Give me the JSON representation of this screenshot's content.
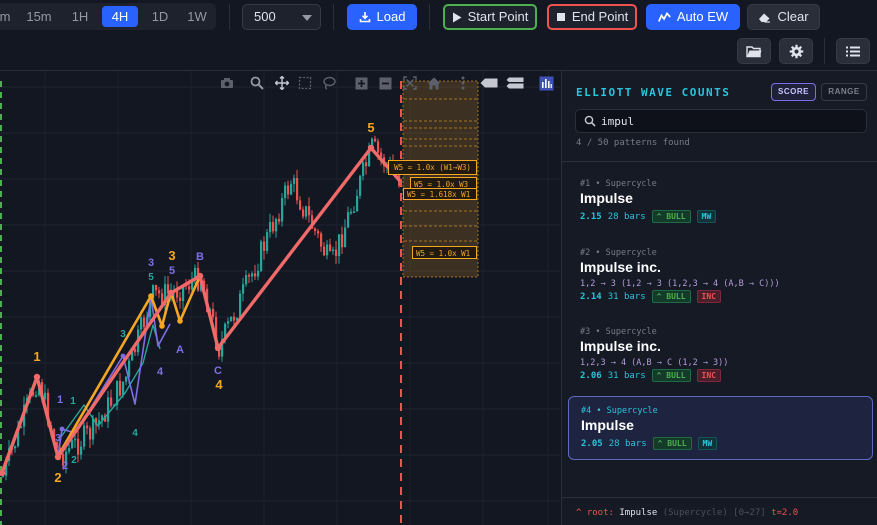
{
  "toolbar": {
    "timeframes": [
      {
        "label": "m",
        "active": false
      },
      {
        "label": "15m",
        "active": false
      },
      {
        "label": "1H",
        "active": false
      },
      {
        "label": "4H",
        "active": true
      },
      {
        "label": "1D",
        "active": false
      },
      {
        "label": "1W",
        "active": false
      }
    ],
    "bars_select": "500",
    "load_label": "Load",
    "start_point_label": "Start Point",
    "end_point_label": "End Point",
    "auto_ew_label": "Auto EW",
    "clear_label": "Clear",
    "icons": [
      "folder-icon",
      "gear-icon",
      "list-icon"
    ]
  },
  "chart": {
    "modebar_icons": [
      "camera-icon",
      "zoom-icon",
      "pan-icon",
      "box-select-icon",
      "lasso-icon",
      "zoom-in-icon",
      "zoom-out-icon",
      "autoscale-icon",
      "reset-icon",
      "spike-icon",
      "hover-closest-icon",
      "hover-compare-icon",
      "bar-chart-logo-icon"
    ],
    "projections": [
      "W5 = 1.0x (W1→W3)",
      "W5 = 1.0x W3",
      "W5 = 1.618x W1",
      "W5 = 1.0x W1"
    ],
    "wave_labels": {
      "p1": "1",
      "p2": "2",
      "p3": "3",
      "p4": "4",
      "p5": "5",
      "p3_alt": "3",
      "p5_alt": "5",
      "a": "A",
      "b": "B",
      "c": "C",
      "s1": "1",
      "s2": "2",
      "s3": "3",
      "s4": "4",
      "s5": "5",
      "t1": "1",
      "t2": "2",
      "t3": "3",
      "t4": "4"
    },
    "colors": {
      "up": "#26a69a",
      "down": "#ef5350",
      "impulse": "#f06a6a",
      "alt": "#f5a623",
      "sub": "#7e6ee6",
      "sub2": "#26a69a"
    }
  },
  "panel": {
    "title": "ELLIOTT WAVE COUNTS",
    "score_label": "SCORE",
    "range_label": "RANGE",
    "search_value": "impul",
    "found_text": "4 / 50 patterns found",
    "cards": [
      {
        "idx": "#1",
        "level": "Supercycle",
        "name": "Impulse",
        "path": "",
        "score": "2.15",
        "bars": "28 bars",
        "dir": "^ BULL",
        "kind": "MW",
        "kind_class": "mw",
        "selected": false
      },
      {
        "idx": "#2",
        "level": "Supercycle",
        "name": "Impulse inc.",
        "path": "1,2 → 3 (1,2 → 3 (1,2,3 → 4 (A,B → C)))",
        "score": "2.14",
        "bars": "31 bars",
        "dir": "^ BULL",
        "kind": "INC",
        "kind_class": "inc",
        "selected": false
      },
      {
        "idx": "#3",
        "level": "Supercycle",
        "name": "Impulse inc.",
        "path": "1,2,3 → 4 (A,B → C (1,2 → 3))",
        "score": "2.06",
        "bars": "31 bars",
        "dir": "^ BULL",
        "kind": "INC",
        "kind_class": "inc",
        "selected": false
      },
      {
        "idx": "#4",
        "level": "Supercycle",
        "name": "Impulse",
        "path": "",
        "score": "2.05",
        "bars": "28 bars",
        "dir": "^ BULL",
        "kind": "MW",
        "kind_class": "mw",
        "selected": true
      }
    ],
    "footer": {
      "prefix": "^ root:",
      "name": "Impulse",
      "level": "(Supercycle) [0→27]",
      "t": "t=2.0"
    }
  }
}
